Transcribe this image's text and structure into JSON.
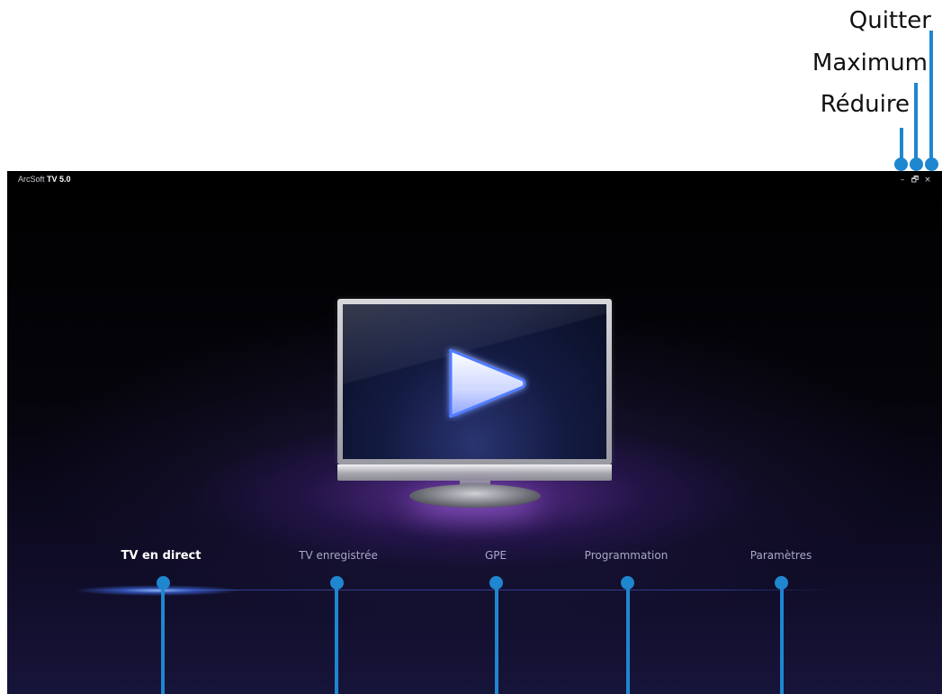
{
  "callouts": {
    "quitter": "Quitter",
    "maximum": "Maximum",
    "reduire": "Réduire",
    "line_color": "#1f86d0"
  },
  "app": {
    "title_prefix": "ArcSoft",
    "title_product": "TV 5.0",
    "window_controls": {
      "minimize": "–",
      "restore": "🗗",
      "close": "×"
    }
  },
  "nav": {
    "items": [
      {
        "label": "TV en direct",
        "active": true
      },
      {
        "label": "TV enregistrée",
        "active": false
      },
      {
        "label": "GPE",
        "active": false
      },
      {
        "label": "Programmation",
        "active": false
      },
      {
        "label": "Paramètres",
        "active": false
      }
    ]
  },
  "icons": {
    "center": "play-icon"
  }
}
